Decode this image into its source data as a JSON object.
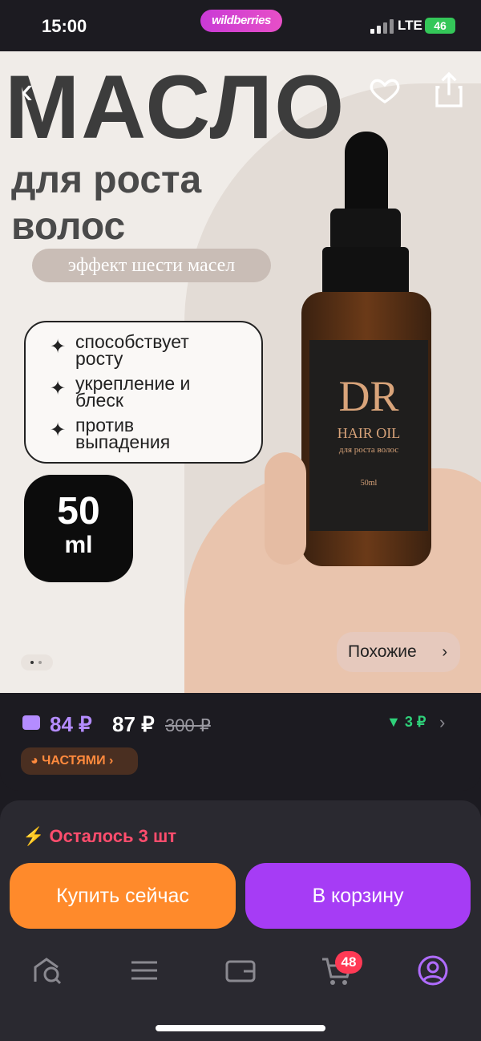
{
  "status_bar": {
    "time": "15:00",
    "brand": "wildberries",
    "network": "LTE",
    "battery": "46"
  },
  "hero": {
    "title": "МАСЛО",
    "subtitle_line1": "для роста",
    "subtitle_line2": "волос",
    "pill": "эффект шести масел",
    "features": [
      {
        "line1": "способствует",
        "line2": "росту"
      },
      {
        "line1": "укрепление и",
        "line2": "блеск"
      },
      {
        "line1": "против",
        "line2": "выпадения"
      }
    ],
    "volume_number": "50",
    "volume_unit": "ml",
    "label_brand": "DR",
    "label_name": "HAIR OIL",
    "label_desc": "для роста волос",
    "label_ml": "50ml",
    "similar_button": "Похожие",
    "gallery_position": 1,
    "gallery_total": 2
  },
  "price": {
    "wallet_price": "84 ₽",
    "price": "87 ₽",
    "old_price": "300 ₽",
    "price_drop": "3 ₽",
    "installments_label": "ЧАСТЯМИ"
  },
  "purchase": {
    "stock_text": "Осталось 3 шт",
    "buy_now_label": "Купить сейчас",
    "add_to_cart_label": "В корзину"
  },
  "nav": {
    "cart_badge": "48",
    "items": [
      "home-search-icon",
      "menu-icon",
      "wallet-icon",
      "cart-icon",
      "profile-icon"
    ]
  },
  "colors": {
    "accent_purple": "#a63cf5",
    "accent_orange": "#ff8a2b",
    "stock_red": "#ff4d6d",
    "brand_pink": "#e74fc7"
  }
}
